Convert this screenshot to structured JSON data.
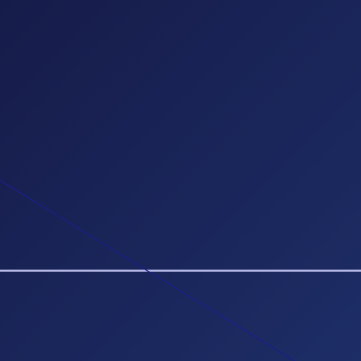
{
  "screen": {
    "background_gradient_start": "#161c4a",
    "background_gradient_end": "#1d2d66"
  },
  "decorations": {
    "horizontal_line_color": "#b6b9e6",
    "diagonal_line_color": "#1b1f86"
  }
}
